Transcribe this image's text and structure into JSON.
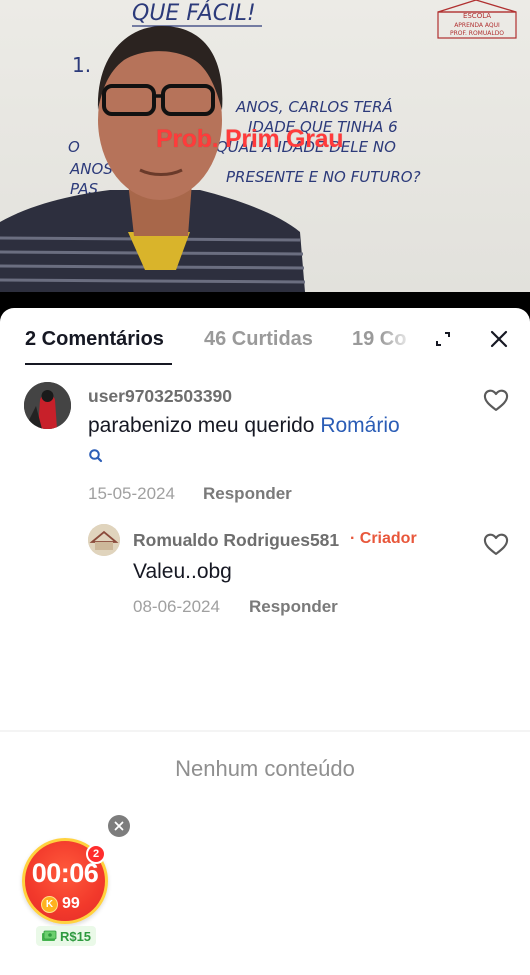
{
  "video": {
    "caption": "Prob. Prim Grau",
    "board_title": "QUE FÁCIL!",
    "board_line_1": "ANOS, CARLOS TERÁ",
    "board_line_2": "IDADE QUE TINHA 6",
    "board_line_3": "QUAL A IDADE DELE NO",
    "board_line_4": "PRESENTE E NO FUTURO?",
    "board_item_number": "1.",
    "logo_line_1": "ESCOLA",
    "logo_line_2": "APRENDA AQUI",
    "logo_line_3": "PROF. ROMUALDO"
  },
  "tabs": [
    {
      "label": "2 Comentários",
      "active": true
    },
    {
      "label": "46 Curtidas",
      "active": false
    },
    {
      "label": "19 Co",
      "active": false
    }
  ],
  "comments": [
    {
      "username": "user97032503390",
      "text": "parabenizo meu querido ",
      "mention": "Romário",
      "date": "15-05-2024",
      "reply_label": "Responder"
    }
  ],
  "replies": [
    {
      "username": "Romualdo Rodrigues581",
      "badge": "· Criador",
      "text": "Valeu..obg",
      "date": "08-06-2024",
      "reply_label": "Responder"
    }
  ],
  "empty_state": "Nenhum conteúdo",
  "reward": {
    "timer": "00:06",
    "coins": "99",
    "coin_letter": "K",
    "badge_count": "2",
    "money": "R$15"
  },
  "colors": {
    "mention": "#2b5db6",
    "creator": "#e8573b",
    "reward_red": "#f2392b",
    "reward_border": "#ffd23f"
  },
  "icons": [
    "expand-icon",
    "close-icon",
    "heart-outline-icon",
    "search-icon",
    "close-circle-icon",
    "coin-icon",
    "money-icon"
  ]
}
